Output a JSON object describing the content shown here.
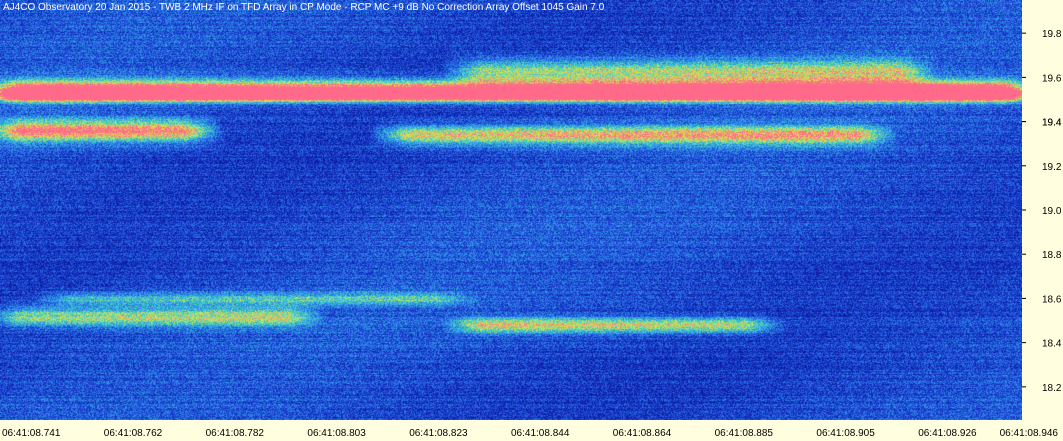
{
  "title": "AJ4CO Observatory 20 Jan 2015 - TWB 2 MHz IF on TFD Array in CP Mode - RCP  MC +9 dB  No Correction Array  Offset 1045  Gain 7.0",
  "chart_data": {
    "type": "heatmap",
    "title": "AJ4CO Observatory 20 Jan 2015 - TWB 2 MHz IF on TFD Array in CP Mode - RCP  MC +9 dB  No Correction Array  Offset 1045  Gain 7.0",
    "xlabel": "",
    "ylabel": "",
    "x_tick_labels": [
      "06:41:08.741",
      "06:41:08.762",
      "06:41:08.782",
      "06:41:08.803",
      "06:41:08.823",
      "06:41:08.844",
      "06:41:08.864",
      "06:41:08.885",
      "06:41:08.905",
      "06:41:08.926",
      "06:41:08.946"
    ],
    "y_tick_labels": [
      "19.8",
      "19.6",
      "19.4",
      "19.4",
      "19.2",
      "19.0",
      "18.8",
      "18.6",
      "18.4",
      "18.2"
    ],
    "y_tick_values": [
      19.8,
      19.6,
      19.4,
      19.4,
      19.2,
      19.0,
      18.8,
      18.6,
      18.4,
      18.2
    ],
    "ylim": [
      18.05,
      19.95
    ],
    "xlim": [
      0,
      1
    ],
    "colormap": [
      "#0a1a9c",
      "#1e46d8",
      "#2f8fe8",
      "#3fd0c8",
      "#d8e84a",
      "#ff6a8a"
    ],
    "bands": [
      {
        "y": 19.55,
        "intensity": 0.85,
        "x_from": 0.0,
        "x_to": 1.0,
        "width": 0.03
      },
      {
        "y": 19.52,
        "intensity": 0.95,
        "x_from": 0.0,
        "x_to": 1.0,
        "width": 0.02
      },
      {
        "y": 19.36,
        "intensity": 0.8,
        "x_from": 0.0,
        "x_to": 0.2,
        "width": 0.035
      },
      {
        "y": 19.34,
        "intensity": 0.7,
        "x_from": 0.38,
        "x_to": 0.86,
        "width": 0.03
      },
      {
        "y": 19.63,
        "intensity": 0.55,
        "x_from": 0.45,
        "x_to": 0.9,
        "width": 0.04
      },
      {
        "y": 18.52,
        "intensity": 0.55,
        "x_from": 0.0,
        "x_to": 0.3,
        "width": 0.03
      },
      {
        "y": 18.48,
        "intensity": 0.6,
        "x_from": 0.45,
        "x_to": 0.75,
        "width": 0.025
      },
      {
        "y": 18.6,
        "intensity": 0.35,
        "x_from": 0.05,
        "x_to": 0.45,
        "width": 0.02
      }
    ],
    "background_level": 0.2,
    "grid": false
  }
}
